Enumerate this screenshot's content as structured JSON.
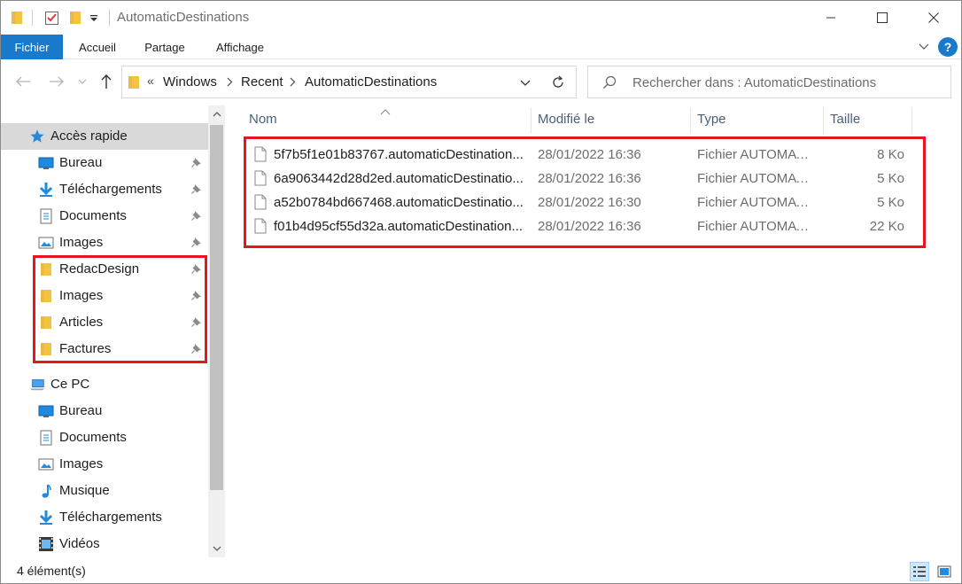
{
  "window": {
    "title": "AutomaticDestinations",
    "minimize_icon": "minimize-icon",
    "maximize_icon": "maximize-icon",
    "close_icon": "close-icon"
  },
  "ribbon": {
    "tabs": [
      "Fichier",
      "Accueil",
      "Partage",
      "Affichage"
    ],
    "help_label": "?",
    "accent": "#1979ca"
  },
  "address": {
    "crumbs": [
      "Windows",
      "Recent",
      "AutomaticDestinations"
    ],
    "overflow": "«",
    "search_placeholder": "Rechercher dans : AutomaticDestinations"
  },
  "nav": {
    "quick_access": {
      "label": "Accès rapide",
      "items": [
        {
          "label": "Bureau",
          "icon": "desktop-icon",
          "pinned": true
        },
        {
          "label": "Téléchargements",
          "icon": "download-icon",
          "pinned": true
        },
        {
          "label": "Documents",
          "icon": "documents-icon",
          "pinned": true
        },
        {
          "label": "Images",
          "icon": "pictures-icon",
          "pinned": true
        },
        {
          "label": "RedacDesign",
          "icon": "folder-icon",
          "pinned": true
        },
        {
          "label": "Images",
          "icon": "folder-icon",
          "pinned": true
        },
        {
          "label": "Articles",
          "icon": "folder-icon",
          "pinned": true
        },
        {
          "label": "Factures",
          "icon": "folder-icon",
          "pinned": true
        }
      ]
    },
    "this_pc": {
      "label": "Ce PC",
      "items": [
        {
          "label": "Bureau",
          "icon": "desktop-icon"
        },
        {
          "label": "Documents",
          "icon": "documents-icon"
        },
        {
          "label": "Images",
          "icon": "pictures-icon"
        },
        {
          "label": "Musique",
          "icon": "music-icon"
        },
        {
          "label": "Téléchargements",
          "icon": "download-icon"
        },
        {
          "label": "Vidéos",
          "icon": "videos-icon"
        }
      ]
    }
  },
  "list": {
    "columns": [
      "Nom",
      "Modifié le",
      "Type",
      "Taille"
    ],
    "rows": [
      {
        "name": "5f7b5f1e01b83767.automaticDestination...",
        "date": "28/01/2022 16:36",
        "type": "Fichier AUTOMATI...",
        "size": "8 Ko"
      },
      {
        "name": "6a9063442d28d2ed.automaticDestinatio...",
        "date": "28/01/2022 16:36",
        "type": "Fichier AUTOMATI...",
        "size": "5 Ko"
      },
      {
        "name": "a52b0784bd667468.automaticDestinatio...",
        "date": "28/01/2022 16:30",
        "type": "Fichier AUTOMATI...",
        "size": "5 Ko"
      },
      {
        "name": "f01b4d95cf55d32a.automaticDestination...",
        "date": "28/01/2022 16:36",
        "type": "Fichier AUTOMATI...",
        "size": "22 Ko"
      }
    ]
  },
  "status": {
    "count": "4 élément(s)"
  },
  "colors": {
    "highlight_red": "#e8141e",
    "folder_yellow": "#f5c342"
  }
}
